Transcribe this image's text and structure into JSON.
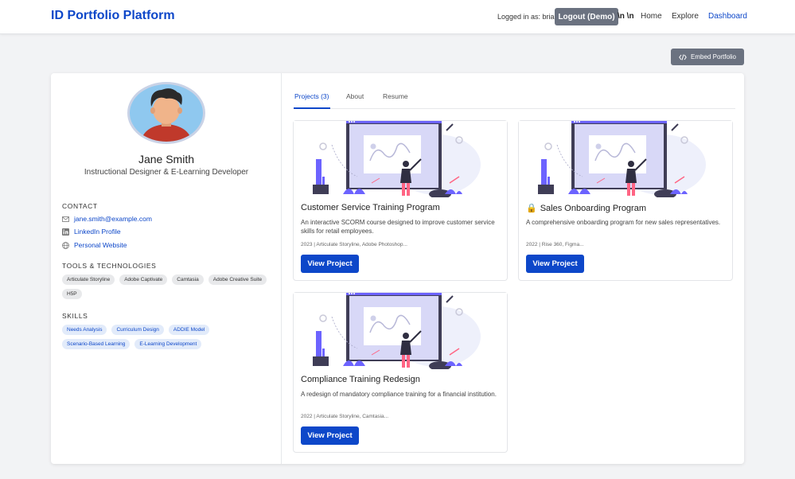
{
  "header": {
    "brand": "ID Portfolio Platform",
    "logged_in": "Logged in as: brian",
    "logout": "Logout (Demo)",
    "stray_text": "\\n \\n",
    "nav": [
      "Home",
      "Explore",
      "Dashboard"
    ]
  },
  "embed_label": "Embed Portfolio",
  "profile": {
    "name": "Jane Smith",
    "title": "Instructional Designer & E-Learning Developer",
    "contact_heading": "CONTACT",
    "contact": [
      {
        "icon": "mail-icon",
        "text": "jane.smith@example.com"
      },
      {
        "icon": "linkedin-icon",
        "text": "LinkedIn Profile"
      },
      {
        "icon": "globe-icon",
        "text": "Personal Website"
      }
    ],
    "tools_heading": "TOOLS & TECHNOLOGIES",
    "tools": [
      "Articulate Storyline",
      "Adobe Captivate",
      "Camtasia",
      "Adobe Creative Suite",
      "H5P"
    ],
    "skills_heading": "SKILLS",
    "skills": [
      "Needs Analysis",
      "Curriculum Design",
      "ADDIE Model",
      "Scenario-Based Learning",
      "E-Learning Development"
    ]
  },
  "tabs": [
    "Projects (3)",
    "About",
    "Resume"
  ],
  "projects": [
    {
      "title": "Customer Service Training Program",
      "locked": false,
      "description": "An interactive SCORM course designed to improve customer service skills for retail employees.",
      "meta": "2023 | Articulate Storyline, Adobe Photoshop...",
      "button": "View Project"
    },
    {
      "title": "Sales Onboarding Program",
      "locked": true,
      "description": "A comprehensive onboarding program for new sales representatives.",
      "meta": "2022 | Rise 360, Figma...",
      "button": "View Project"
    },
    {
      "title": "Compliance Training Redesign",
      "locked": false,
      "description": "A redesign of mandatory compliance training for a financial institution.",
      "meta": "2022 | Articulate Storyline, Camtasia...",
      "button": "View Project"
    }
  ],
  "colors": {
    "brand": "#0d47c9",
    "button_gray": "#6b7280",
    "illustration_purple": "#6c63ff"
  }
}
